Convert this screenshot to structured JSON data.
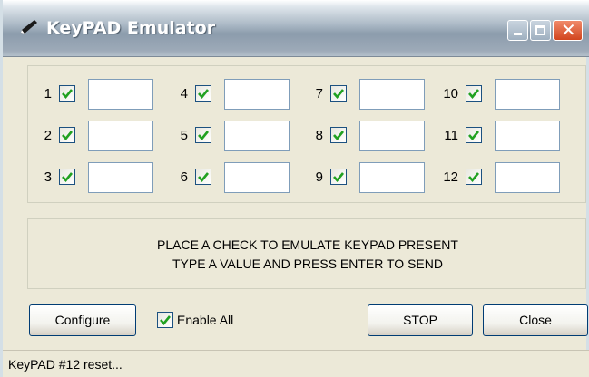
{
  "window": {
    "title": "KeyPAD Emulator"
  },
  "keypads": [
    {
      "number": "1",
      "checked": true,
      "value": ""
    },
    {
      "number": "2",
      "checked": true,
      "value": ""
    },
    {
      "number": "3",
      "checked": true,
      "value": ""
    },
    {
      "number": "4",
      "checked": true,
      "value": ""
    },
    {
      "number": "5",
      "checked": true,
      "value": ""
    },
    {
      "number": "6",
      "checked": true,
      "value": ""
    },
    {
      "number": "7",
      "checked": true,
      "value": ""
    },
    {
      "number": "8",
      "checked": true,
      "value": ""
    },
    {
      "number": "9",
      "checked": true,
      "value": ""
    },
    {
      "number": "10",
      "checked": true,
      "value": ""
    },
    {
      "number": "11",
      "checked": true,
      "value": ""
    },
    {
      "number": "12",
      "checked": true,
      "value": ""
    }
  ],
  "instructions": {
    "line1": "PLACE A CHECK TO EMULATE KEYPAD PRESENT",
    "line2": "TYPE A VALUE AND PRESS ENTER TO SEND"
  },
  "buttons": {
    "configure": "Configure",
    "stop": "STOP",
    "close": "Close"
  },
  "enable_all": {
    "label": "Enable All",
    "checked": true
  },
  "status": {
    "text": "KeyPAD #12 reset..."
  },
  "colors": {
    "checkmark": "#21a121",
    "close_button": "#d2451e"
  },
  "icons": {
    "app": "pencil-icon",
    "minimize": "minimize-icon",
    "maximize": "maximize-icon",
    "close": "close-icon",
    "checkbox": "checkmark-icon"
  }
}
